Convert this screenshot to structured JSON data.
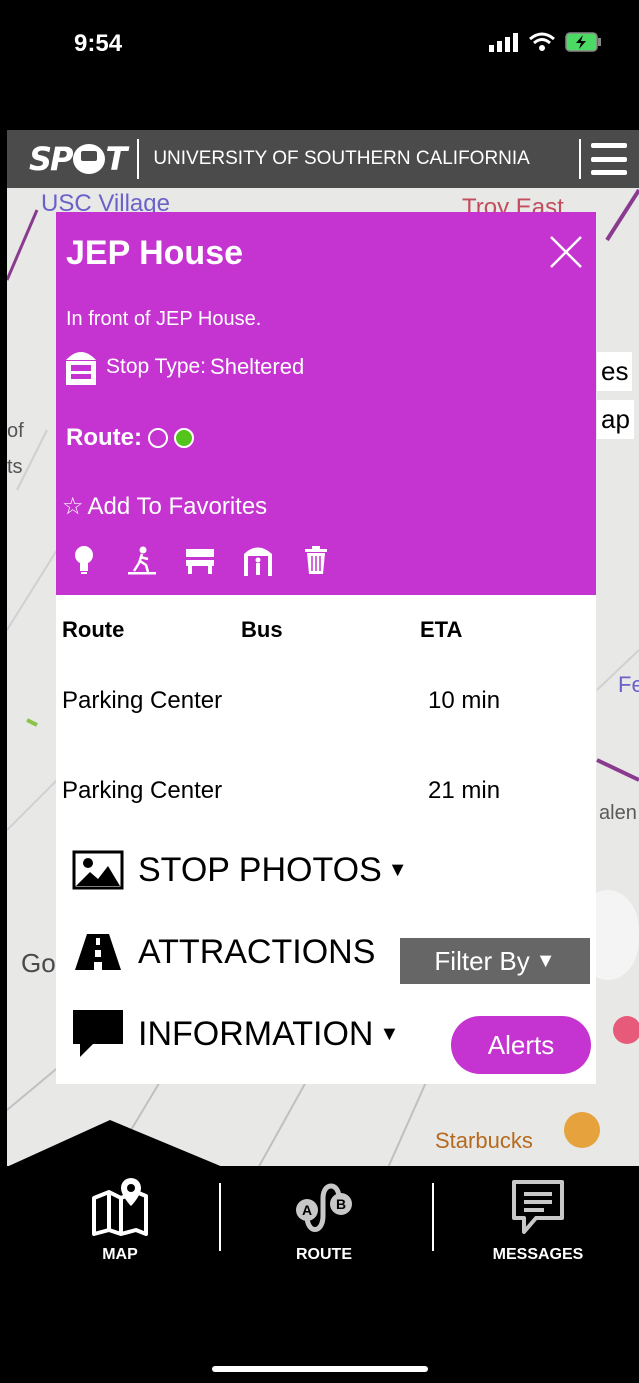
{
  "status_bar": {
    "time": "9:54"
  },
  "header": {
    "logo": "SPOT",
    "logo_left": "SP",
    "logo_right": "T",
    "university": "UNIVERSITY OF SOUTHERN CALIFORNIA"
  },
  "map": {
    "labels": [
      "USC Village",
      "Troy East",
      "es",
      "ap",
      "Fe",
      "alen",
      "Starbucks",
      "Go",
      "of",
      "ts"
    ]
  },
  "popup": {
    "title": "JEP House",
    "description": "In front of JEP House.",
    "stop_type_label": "Stop Type:",
    "stop_type_value": "Sheltered",
    "route_label": "Route:",
    "add_favorites": "Add To Favorites",
    "amenities": [
      "lightbulb-icon",
      "walking-icon",
      "bench-icon",
      "shelter-icon",
      "trash-icon"
    ],
    "table": {
      "headers": [
        "Route",
        "Bus",
        "ETA"
      ],
      "rows": [
        {
          "route": "Parking Center",
          "bus": "",
          "eta": "10 min"
        },
        {
          "route": "Parking Center",
          "bus": "",
          "eta": "21 min"
        }
      ]
    },
    "sections": {
      "photos": "STOP PHOTOS",
      "attractions": "ATTRACTIONS",
      "information": "INFORMATION"
    },
    "filter_label": "Filter By",
    "alerts_label": "Alerts"
  },
  "nav": {
    "items": [
      {
        "label": "MAP",
        "icon": "map-icon"
      },
      {
        "label": "ROUTE",
        "icon": "route-icon"
      },
      {
        "label": "MESSAGES",
        "icon": "messages-icon"
      }
    ]
  },
  "colors": {
    "accent": "#c534d0",
    "header": "#4b4b4b",
    "route_green": "#52c41a"
  }
}
